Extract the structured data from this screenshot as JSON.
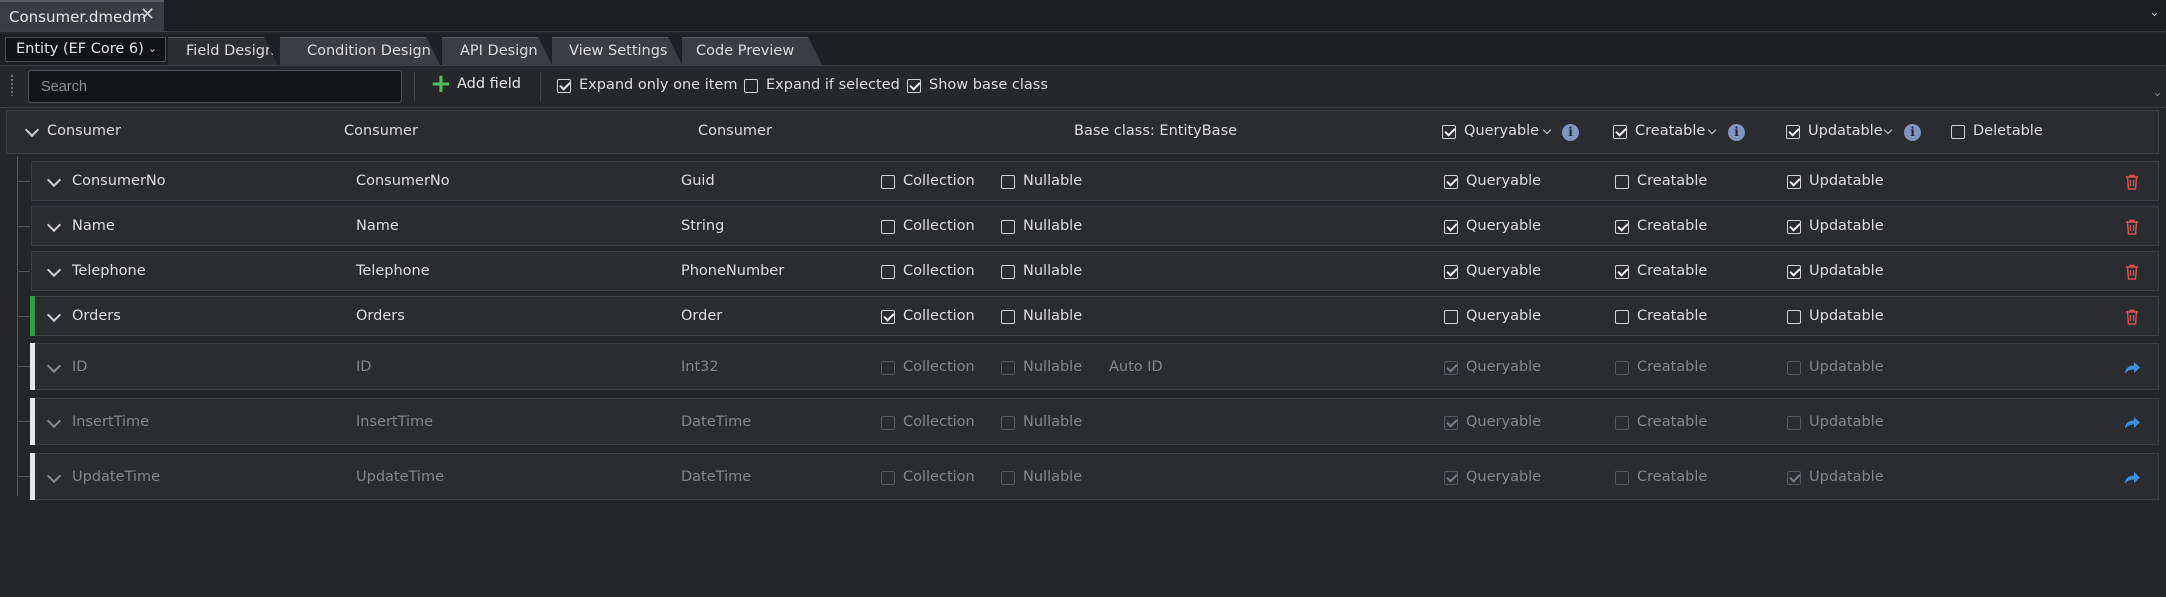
{
  "document_tab": {
    "title": "Consumer.dmedm",
    "close_icon": "close-icon"
  },
  "entity_selector": {
    "value": "Entity (EF Core 6)"
  },
  "designer_tabs": [
    "Field Design",
    "Condition Design",
    "API Design",
    "View Settings",
    "Code Preview"
  ],
  "toolbar": {
    "search_placeholder": "Search",
    "add_field_label": "Add field",
    "expand_only_one": {
      "label": "Expand only one item",
      "checked": true
    },
    "expand_if_selected": {
      "label": "Expand if selected",
      "checked": false
    },
    "show_base_class": {
      "label": "Show base class",
      "checked": true
    }
  },
  "entity_header": {
    "name": "Consumer",
    "display_name": "Consumer",
    "table_name": "Consumer",
    "base_class": "Base class: EntityBase",
    "queryable": {
      "label": "Queryable",
      "checked": true
    },
    "creatable": {
      "label": "Creatable",
      "checked": true
    },
    "updatable": {
      "label": "Updatable",
      "checked": true
    },
    "deletable": {
      "label": "Deletable",
      "checked": false
    }
  },
  "labels": {
    "collection": "Collection",
    "nullable": "Nullable",
    "queryable": "Queryable",
    "creatable": "Creatable",
    "updatable": "Updatable"
  },
  "fields": [
    {
      "name": "ConsumerNo",
      "display": "ConsumerNo",
      "type": "Guid",
      "collection": false,
      "nullable": false,
      "extra": "",
      "queryable": true,
      "creatable": false,
      "updatable": true,
      "inherited": false,
      "marker": "",
      "action_icon": "trash-icon"
    },
    {
      "name": "Name",
      "display": "Name",
      "type": "String",
      "collection": false,
      "nullable": false,
      "extra": "",
      "queryable": true,
      "creatable": true,
      "updatable": true,
      "inherited": false,
      "marker": "",
      "action_icon": "trash-icon"
    },
    {
      "name": "Telephone",
      "display": "Telephone",
      "type": "PhoneNumber",
      "collection": false,
      "nullable": false,
      "extra": "",
      "queryable": true,
      "creatable": true,
      "updatable": true,
      "inherited": false,
      "marker": "",
      "action_icon": "trash-icon"
    },
    {
      "name": "Orders",
      "display": "Orders",
      "type": "Order",
      "collection": true,
      "nullable": false,
      "extra": "",
      "queryable": false,
      "creatable": false,
      "updatable": false,
      "inherited": false,
      "marker": "green",
      "action_icon": "trash-icon"
    },
    {
      "name": "ID",
      "display": "ID",
      "type": "Int32",
      "collection": false,
      "nullable": false,
      "extra": "Auto ID",
      "queryable": true,
      "creatable": false,
      "updatable": false,
      "inherited": true,
      "marker": "white",
      "action_icon": "share-arrow-icon"
    },
    {
      "name": "InsertTime",
      "display": "InsertTime",
      "type": "DateTime",
      "collection": false,
      "nullable": false,
      "extra": "",
      "queryable": true,
      "creatable": false,
      "updatable": false,
      "inherited": true,
      "marker": "white",
      "action_icon": "share-arrow-icon"
    },
    {
      "name": "UpdateTime",
      "display": "UpdateTime",
      "type": "DateTime",
      "collection": false,
      "nullable": false,
      "extra": "",
      "queryable": true,
      "creatable": false,
      "updatable": true,
      "inherited": true,
      "marker": "white",
      "action_icon": "share-arrow-icon"
    }
  ],
  "colors": {
    "accent_green": "#2ea043",
    "delete_red": "#d9534f",
    "link_blue": "#3b8fe0",
    "info_blue": "#7f95c4"
  }
}
